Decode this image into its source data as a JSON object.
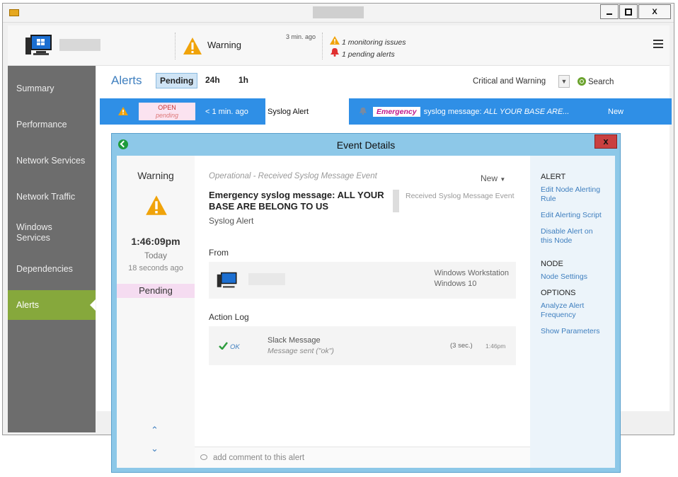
{
  "window": {
    "close_glyph": "X"
  },
  "header": {
    "status_label": "Warning",
    "time_ago": "3 min. ago",
    "monitoring_issues": "1 monitoring issues",
    "pending_alerts": "1 pending alerts"
  },
  "sidebar": {
    "items": [
      {
        "label": "Summary"
      },
      {
        "label": "Performance"
      },
      {
        "label": "Network Services"
      },
      {
        "label": "Network Traffic"
      },
      {
        "label": "Windows Services"
      },
      {
        "label": "Dependencies"
      },
      {
        "label": "Alerts"
      }
    ],
    "active_index": 6
  },
  "alerts": {
    "title": "Alerts",
    "tabs": [
      "Pending",
      "24h",
      "1h"
    ],
    "active_tab": "Pending",
    "filter_value": "Critical and Warning",
    "search_label": "Search",
    "row": {
      "status_top": "OPEN",
      "status_bottom": "pending",
      "time": "< 1 min. ago",
      "name": "Syslog Alert",
      "severity_badge": "Emergency",
      "message_prefix": "syslog message:",
      "message_text": "ALL YOUR BASE ARE...",
      "state": "New"
    }
  },
  "dialog": {
    "title": "Event Details",
    "close_glyph": "x",
    "left": {
      "severity": "Warning",
      "time": "1:46:09pm",
      "day": "Today",
      "elapsed": "18 seconds ago",
      "state": "Pending"
    },
    "center": {
      "category": "Operational - Received Syslog Message Event",
      "state_dropdown": "New",
      "headline": "Emergency syslog message: ALL YOUR BASE ARE BELONG TO US",
      "alert_name": "Syslog Alert",
      "side_label": "Received Syslog Message Event",
      "from_heading": "From",
      "node_type": "Windows Workstation",
      "node_os": "Windows 10",
      "action_log_heading": "Action Log",
      "action": {
        "status": "OK",
        "name": "Slack Message",
        "detail": "Message sent (\"ok\")",
        "duration": "(3 sec.)",
        "time": "1:46pm"
      },
      "comment_placeholder": "add comment to this alert"
    },
    "right": {
      "alert_heading": "ALERT",
      "edit_node_alerting_rule": "Edit Node Alerting Rule",
      "edit_alerting_script": "Edit Alerting Script",
      "disable_alert": "Disable Alert on this Node",
      "node_heading": "NODE",
      "node_settings": "Node Settings",
      "options_heading": "OPTIONS",
      "analyze_frequency": "Analyze Alert Frequency",
      "show_parameters": "Show Parameters"
    }
  },
  "colors": {
    "accent_blue": "#2f8fe6",
    "sidebar_active": "#86a83c",
    "warning_orange": "#f0a30a",
    "emergency_pink": "#c2168a",
    "dialog_frame": "#8dc8e8"
  }
}
